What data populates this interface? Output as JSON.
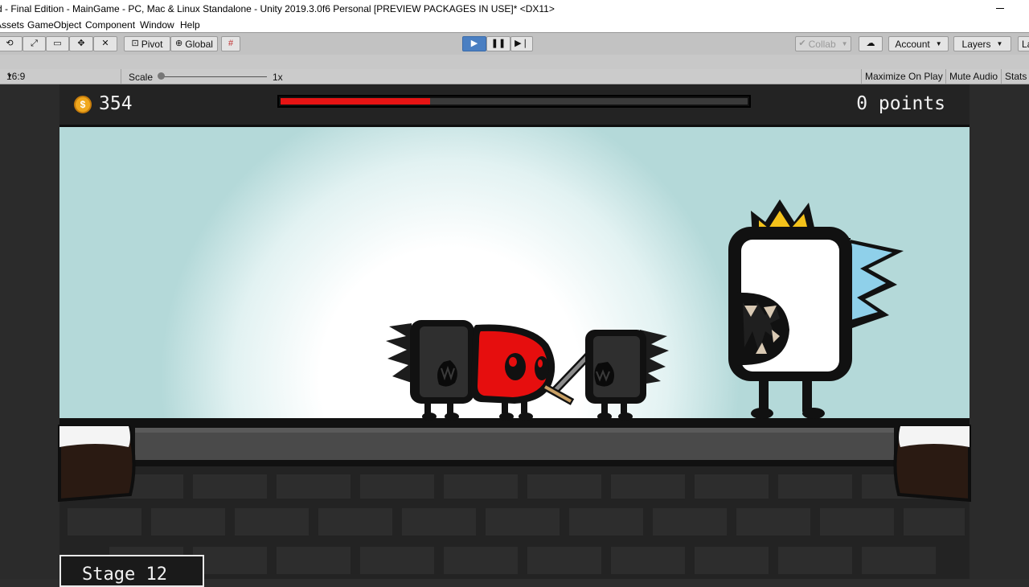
{
  "window": {
    "title": "d - Final Edition - MainGame - PC, Mac & Linux Standalone - Unity 2019.3.0f6 Personal [PREVIEW PACKAGES IN USE]* <DX11>"
  },
  "menu": {
    "items": [
      "Assets",
      "GameObject",
      "Component",
      "Window",
      "Help"
    ]
  },
  "toolbar": {
    "pivot_label": "Pivot",
    "global_label": "Global",
    "collab_label": "Collab",
    "account_label": "Account",
    "layers_label": "Layers",
    "layout_label": "La"
  },
  "game_view": {
    "aspect": "16:9",
    "scale_label": "Scale",
    "scale_value": "1x",
    "maximize_label": "Maximize On Play",
    "mute_label": "Mute Audio",
    "stats_label": "Stats"
  },
  "hud": {
    "coins": "354",
    "coin_symbol": "$",
    "health_fraction": 0.32,
    "points": "0 points",
    "stage": "Stage 12"
  },
  "colors": {
    "play_active": "#4a7fc2",
    "health": "#e61414",
    "sky": "#b4d9d9",
    "coin": "#f0a81e",
    "player": "#e60e0e",
    "crown": "#f4c21a",
    "boss_spikes": "#8fd0ea"
  }
}
